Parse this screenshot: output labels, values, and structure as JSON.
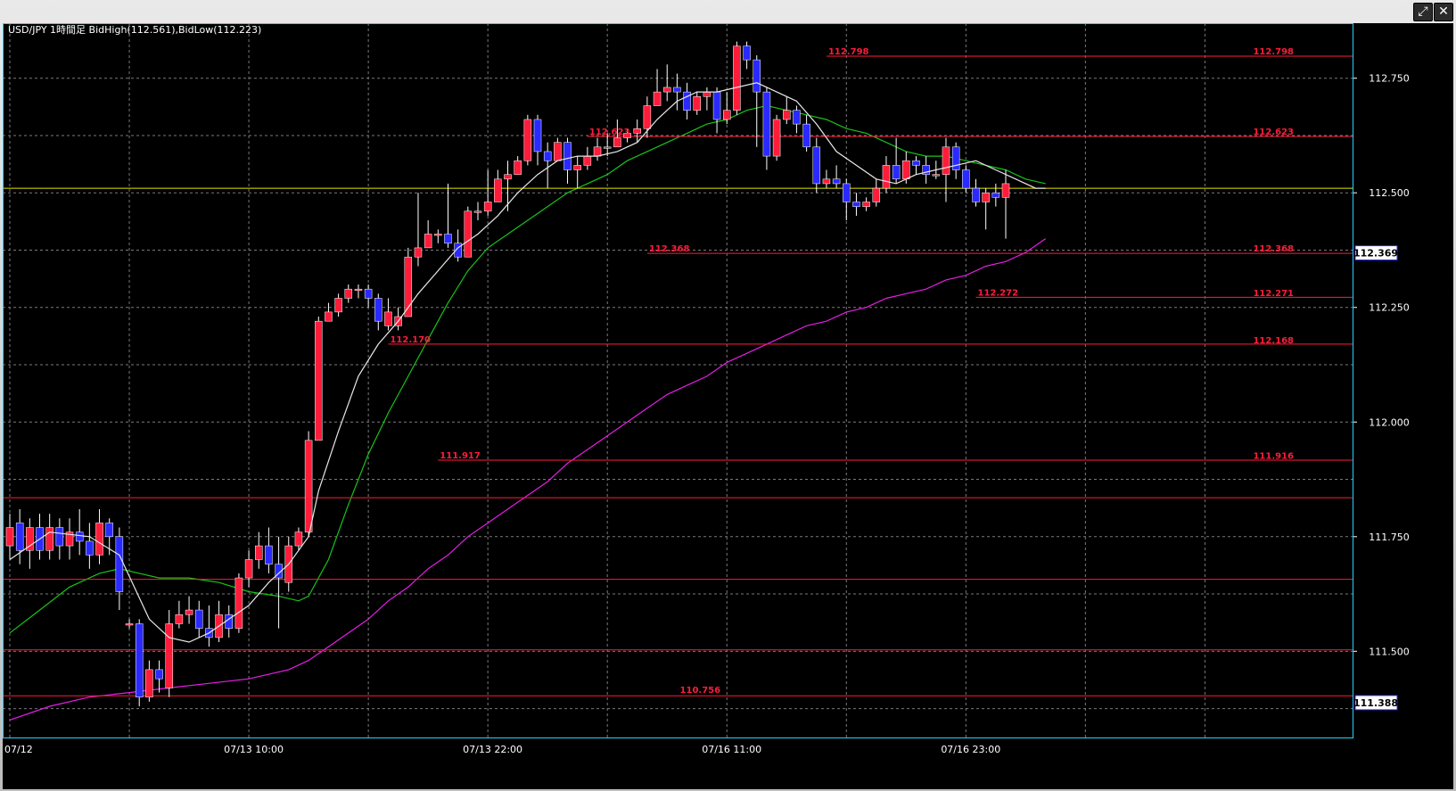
{
  "window": {
    "restore_icon": "restore-icon",
    "restore_glyph": "⤢",
    "close_icon": "close-icon",
    "close_glyph": "✕"
  },
  "colors": {
    "background": "#000000",
    "grid": "#7a7a7a",
    "bull": "#ff1c3a",
    "bear": "#2a2aff",
    "ma_fast": "#e8e8e8",
    "ma_mid": "#18c418",
    "ma_slow": "#e61ee6",
    "hline": "#ff1c3a",
    "hline_yellow": "#e5e500",
    "label_red": "#ff1c3a",
    "axis_text": "#ffffff"
  },
  "chart_data": {
    "type": "candlestick",
    "title": "USD/JPY 1時間足  BidHigh(112.561),BidLow(112.223)",
    "ylim": [
      111.31,
      112.87
    ],
    "y_ticks": [
      "112.750",
      "112.500",
      "112.250",
      "112.000",
      "111.750",
      "111.500"
    ],
    "x_ticks": [
      {
        "label": "07/12",
        "index": 0
      },
      {
        "label": "07/13 10:00",
        "index": 24
      },
      {
        "label": "07/13 22:00",
        "index": 48
      },
      {
        "label": "07/16 11:00",
        "index": 72
      },
      {
        "label": "07/16 23:00",
        "index": 96
      }
    ],
    "price_tags": [
      {
        "label": "112.369",
        "value": 112.369
      },
      {
        "label": "111.388",
        "value": 111.388
      }
    ],
    "horizontal_lines": [
      {
        "value": 112.798,
        "label": "112.798",
        "color": "red",
        "start_index": 82
      },
      {
        "value": 112.623,
        "label": "112.623",
        "color": "red",
        "start_index": 58
      },
      {
        "value": 112.368,
        "label": "112.368",
        "color": "red",
        "start_index": 64
      },
      {
        "value": 112.51,
        "label": "",
        "color": "yellow",
        "start_index": 0
      },
      {
        "value": 112.272,
        "label": "112.272",
        "color": "red",
        "start_index": 97
      },
      {
        "value": 112.17,
        "label": "112.170",
        "color": "red",
        "start_index": 38
      },
      {
        "value": 111.917,
        "label": "111.917",
        "color": "red",
        "start_index": 43
      },
      {
        "value": 111.835,
        "label": "",
        "color": "red",
        "start_index": 0
      },
      {
        "value": 111.657,
        "label": "",
        "color": "red",
        "start_index": 0
      },
      {
        "value": 111.503,
        "label": "",
        "color": "red",
        "start_index": 0
      },
      {
        "value": 111.403,
        "label": "",
        "color": "red",
        "start_index": 0
      }
    ],
    "right_labels": [
      {
        "value": 112.798,
        "label": "112.798"
      },
      {
        "value": 112.623,
        "label": "112.623"
      },
      {
        "value": 112.368,
        "label": "112.368"
      },
      {
        "value": 112.271,
        "label": "112.271"
      },
      {
        "value": 112.168,
        "label": "112.168"
      },
      {
        "value": 111.916,
        "label": "111.916"
      }
    ],
    "bottom_label": {
      "value": 111.403,
      "label": "110.756",
      "index": 68
    },
    "candles": [
      [
        111.73,
        111.77,
        111.8,
        111.7
      ],
      [
        111.78,
        111.72,
        111.81,
        111.69
      ],
      [
        111.72,
        111.77,
        111.79,
        111.68
      ],
      [
        111.77,
        111.72,
        111.8,
        111.7
      ],
      [
        111.72,
        111.77,
        111.8,
        111.7
      ],
      [
        111.77,
        111.73,
        111.79,
        111.7
      ],
      [
        111.73,
        111.76,
        111.79,
        111.7
      ],
      [
        111.76,
        111.74,
        111.81,
        111.71
      ],
      [
        111.74,
        111.71,
        111.78,
        111.68
      ],
      [
        111.71,
        111.78,
        111.81,
        111.69
      ],
      [
        111.78,
        111.75,
        111.79,
        111.71
      ],
      [
        111.75,
        111.63,
        111.77,
        111.59
      ],
      [
        111.56,
        111.56,
        111.57,
        111.55
      ],
      [
        111.56,
        111.4,
        111.57,
        111.38
      ],
      [
        111.4,
        111.46,
        111.48,
        111.39
      ],
      [
        111.46,
        111.44,
        111.48,
        111.41
      ],
      [
        111.42,
        111.56,
        111.59,
        111.4
      ],
      [
        111.56,
        111.58,
        111.61,
        111.55
      ],
      [
        111.58,
        111.59,
        111.62,
        111.56
      ],
      [
        111.59,
        111.55,
        111.61,
        111.53
      ],
      [
        111.55,
        111.53,
        111.6,
        111.51
      ],
      [
        111.53,
        111.58,
        111.61,
        111.52
      ],
      [
        111.58,
        111.55,
        111.6,
        111.53
      ],
      [
        111.55,
        111.66,
        111.67,
        111.54
      ],
      [
        111.66,
        111.7,
        111.72,
        111.64
      ],
      [
        111.7,
        111.73,
        111.76,
        111.68
      ],
      [
        111.73,
        111.69,
        111.77,
        111.67
      ],
      [
        111.69,
        111.66,
        111.75,
        111.55
      ],
      [
        111.65,
        111.73,
        111.75,
        111.63
      ],
      [
        111.73,
        111.76,
        111.77,
        111.72
      ],
      [
        111.76,
        111.96,
        111.98,
        111.75
      ],
      [
        111.96,
        112.22,
        112.23,
        112.0
      ],
      [
        112.22,
        112.24,
        112.26,
        112.22
      ],
      [
        112.24,
        112.27,
        112.28,
        112.23
      ],
      [
        112.27,
        112.29,
        112.3,
        112.26
      ],
      [
        112.29,
        112.29,
        112.3,
        112.27
      ],
      [
        112.29,
        112.27,
        112.3,
        112.25
      ],
      [
        112.27,
        112.22,
        112.28,
        112.2
      ],
      [
        112.21,
        112.24,
        112.27,
        112.2
      ],
      [
        112.21,
        112.23,
        112.25,
        112.2
      ],
      [
        112.23,
        112.36,
        112.38,
        112.24
      ],
      [
        112.36,
        112.38,
        112.5,
        112.34
      ],
      [
        112.38,
        112.41,
        112.44,
        112.38
      ],
      [
        112.41,
        112.41,
        112.42,
        112.39
      ],
      [
        112.41,
        112.39,
        112.52,
        112.38
      ],
      [
        112.39,
        112.36,
        112.42,
        112.35
      ],
      [
        112.36,
        112.46,
        112.47,
        112.4
      ],
      [
        112.46,
        112.46,
        112.48,
        112.44
      ],
      [
        112.46,
        112.48,
        112.55,
        112.45
      ],
      [
        112.48,
        112.53,
        112.55,
        112.48
      ],
      [
        112.53,
        112.54,
        112.57,
        112.46
      ],
      [
        112.54,
        112.57,
        112.58,
        112.54
      ],
      [
        112.57,
        112.66,
        112.67,
        112.56
      ],
      [
        112.66,
        112.59,
        112.67,
        112.56
      ],
      [
        112.59,
        112.57,
        112.61,
        112.51
      ],
      [
        112.57,
        112.61,
        112.62,
        112.57
      ],
      [
        112.61,
        112.55,
        112.62,
        112.52
      ],
      [
        112.55,
        112.56,
        112.58,
        112.51
      ],
      [
        112.56,
        112.58,
        112.6,
        112.55
      ],
      [
        112.58,
        112.6,
        112.62,
        112.57
      ],
      [
        112.6,
        112.6,
        112.63,
        112.58
      ],
      [
        112.6,
        112.62,
        112.66,
        112.6
      ],
      [
        112.62,
        112.63,
        112.64,
        112.61
      ],
      [
        112.63,
        112.64,
        112.66,
        112.61
      ],
      [
        112.64,
        112.69,
        112.71,
        112.62
      ],
      [
        112.69,
        112.72,
        112.77,
        112.69
      ],
      [
        112.72,
        112.73,
        112.78,
        112.7
      ],
      [
        112.73,
        112.72,
        112.76,
        112.68
      ],
      [
        112.72,
        112.68,
        112.74,
        112.66
      ],
      [
        112.68,
        112.71,
        112.72,
        112.67
      ],
      [
        112.71,
        112.72,
        112.73,
        112.68
      ],
      [
        112.72,
        112.66,
        112.73,
        112.63
      ],
      [
        112.66,
        112.68,
        112.72,
        112.65
      ],
      [
        112.68,
        112.82,
        112.83,
        112.67
      ],
      [
        112.82,
        112.79,
        112.83,
        112.77
      ],
      [
        112.79,
        112.72,
        112.8,
        112.6
      ],
      [
        112.72,
        112.58,
        112.73,
        112.55
      ],
      [
        112.58,
        112.66,
        112.67,
        112.57
      ],
      [
        112.66,
        112.68,
        112.71,
        112.65
      ],
      [
        112.68,
        112.65,
        112.69,
        112.63
      ],
      [
        112.65,
        112.6,
        112.67,
        112.59
      ],
      [
        112.6,
        112.52,
        112.62,
        112.5
      ],
      [
        112.52,
        112.53,
        112.55,
        112.51
      ],
      [
        112.53,
        112.52,
        112.56,
        112.51
      ],
      [
        112.52,
        112.48,
        112.53,
        112.44
      ],
      [
        112.48,
        112.47,
        112.5,
        112.45
      ],
      [
        112.47,
        112.48,
        112.49,
        112.46
      ],
      [
        112.48,
        112.51,
        112.53,
        112.47
      ],
      [
        112.51,
        112.56,
        112.58,
        112.5
      ],
      [
        112.56,
        112.53,
        112.62,
        112.52
      ],
      [
        112.53,
        112.57,
        112.59,
        112.52
      ],
      [
        112.57,
        112.56,
        112.58,
        112.54
      ],
      [
        112.56,
        112.54,
        112.58,
        112.52
      ],
      [
        112.54,
        112.54,
        112.57,
        112.53
      ],
      [
        112.54,
        112.6,
        112.62,
        112.48
      ],
      [
        112.6,
        112.55,
        112.61,
        112.53
      ],
      [
        112.55,
        112.51,
        112.56,
        112.5
      ],
      [
        112.51,
        112.48,
        112.53,
        112.47
      ],
      [
        112.48,
        112.5,
        112.51,
        112.42
      ],
      [
        112.5,
        112.49,
        112.52,
        112.47
      ],
      [
        112.49,
        112.52,
        112.55,
        112.4
      ]
    ],
    "ma_fast": [
      [
        0,
        111.7
      ],
      [
        4,
        111.76
      ],
      [
        8,
        111.75
      ],
      [
        11,
        111.71
      ],
      [
        14,
        111.57
      ],
      [
        16,
        111.53
      ],
      [
        18,
        111.52
      ],
      [
        20,
        111.54
      ],
      [
        22,
        111.57
      ],
      [
        24,
        111.6
      ],
      [
        26,
        111.65
      ],
      [
        28,
        111.69
      ],
      [
        30,
        111.75
      ],
      [
        31,
        111.85
      ],
      [
        33,
        111.98
      ],
      [
        35,
        112.1
      ],
      [
        37,
        112.17
      ],
      [
        39,
        112.22
      ],
      [
        41,
        112.28
      ],
      [
        43,
        112.33
      ],
      [
        45,
        112.38
      ],
      [
        47,
        112.41
      ],
      [
        49,
        112.45
      ],
      [
        51,
        112.5
      ],
      [
        53,
        112.54
      ],
      [
        55,
        112.57
      ],
      [
        57,
        112.58
      ],
      [
        59,
        112.58
      ],
      [
        61,
        112.59
      ],
      [
        63,
        112.61
      ],
      [
        65,
        112.66
      ],
      [
        67,
        112.7
      ],
      [
        69,
        112.72
      ],
      [
        71,
        112.72
      ],
      [
        73,
        112.73
      ],
      [
        75,
        112.74
      ],
      [
        77,
        112.72
      ],
      [
        79,
        112.7
      ],
      [
        81,
        112.65
      ],
      [
        83,
        112.59
      ],
      [
        85,
        112.56
      ],
      [
        87,
        112.53
      ],
      [
        89,
        112.52
      ],
      [
        91,
        112.54
      ],
      [
        93,
        112.55
      ],
      [
        95,
        112.56
      ],
      [
        97,
        112.57
      ],
      [
        99,
        112.55
      ],
      [
        101,
        112.53
      ],
      [
        103,
        112.51
      ],
      [
        104,
        112.51
      ]
    ],
    "ma_mid": [
      [
        0,
        111.54
      ],
      [
        3,
        111.59
      ],
      [
        6,
        111.64
      ],
      [
        9,
        111.67
      ],
      [
        11,
        111.68
      ],
      [
        13,
        111.67
      ],
      [
        15,
        111.66
      ],
      [
        18,
        111.66
      ],
      [
        21,
        111.65
      ],
      [
        24,
        111.63
      ],
      [
        27,
        111.62
      ],
      [
        29,
        111.61
      ],
      [
        30,
        111.62
      ],
      [
        32,
        111.7
      ],
      [
        34,
        111.82
      ],
      [
        36,
        111.93
      ],
      [
        38,
        112.02
      ],
      [
        40,
        112.1
      ],
      [
        42,
        112.18
      ],
      [
        44,
        112.26
      ],
      [
        46,
        112.33
      ],
      [
        48,
        112.38
      ],
      [
        50,
        112.41
      ],
      [
        52,
        112.44
      ],
      [
        54,
        112.47
      ],
      [
        56,
        112.5
      ],
      [
        58,
        112.52
      ],
      [
        60,
        112.54
      ],
      [
        62,
        112.57
      ],
      [
        64,
        112.59
      ],
      [
        66,
        112.61
      ],
      [
        68,
        112.63
      ],
      [
        70,
        112.65
      ],
      [
        72,
        112.66
      ],
      [
        74,
        112.68
      ],
      [
        76,
        112.69
      ],
      [
        78,
        112.68
      ],
      [
        80,
        112.67
      ],
      [
        82,
        112.66
      ],
      [
        84,
        112.64
      ],
      [
        86,
        112.63
      ],
      [
        88,
        112.61
      ],
      [
        90,
        112.59
      ],
      [
        92,
        112.58
      ],
      [
        94,
        112.58
      ],
      [
        96,
        112.57
      ],
      [
        98,
        112.56
      ],
      [
        100,
        112.55
      ],
      [
        102,
        112.53
      ],
      [
        104,
        112.52
      ]
    ],
    "ma_slow": [
      [
        0,
        111.35
      ],
      [
        4,
        111.38
      ],
      [
        8,
        111.4
      ],
      [
        12,
        111.41
      ],
      [
        16,
        111.42
      ],
      [
        20,
        111.43
      ],
      [
        24,
        111.44
      ],
      [
        28,
        111.46
      ],
      [
        30,
        111.48
      ],
      [
        32,
        111.51
      ],
      [
        34,
        111.54
      ],
      [
        36,
        111.57
      ],
      [
        38,
        111.61
      ],
      [
        40,
        111.64
      ],
      [
        42,
        111.68
      ],
      [
        44,
        111.71
      ],
      [
        46,
        111.75
      ],
      [
        48,
        111.78
      ],
      [
        50,
        111.81
      ],
      [
        52,
        111.84
      ],
      [
        54,
        111.87
      ],
      [
        56,
        111.91
      ],
      [
        58,
        111.94
      ],
      [
        60,
        111.97
      ],
      [
        62,
        112.0
      ],
      [
        64,
        112.03
      ],
      [
        66,
        112.06
      ],
      [
        68,
        112.08
      ],
      [
        70,
        112.1
      ],
      [
        72,
        112.13
      ],
      [
        74,
        112.15
      ],
      [
        76,
        112.17
      ],
      [
        78,
        112.19
      ],
      [
        80,
        112.21
      ],
      [
        82,
        112.22
      ],
      [
        84,
        112.24
      ],
      [
        86,
        112.25
      ],
      [
        88,
        112.27
      ],
      [
        90,
        112.28
      ],
      [
        92,
        112.29
      ],
      [
        94,
        112.31
      ],
      [
        96,
        112.32
      ],
      [
        98,
        112.34
      ],
      [
        100,
        112.35
      ],
      [
        102,
        112.37
      ],
      [
        104,
        112.4
      ]
    ]
  }
}
